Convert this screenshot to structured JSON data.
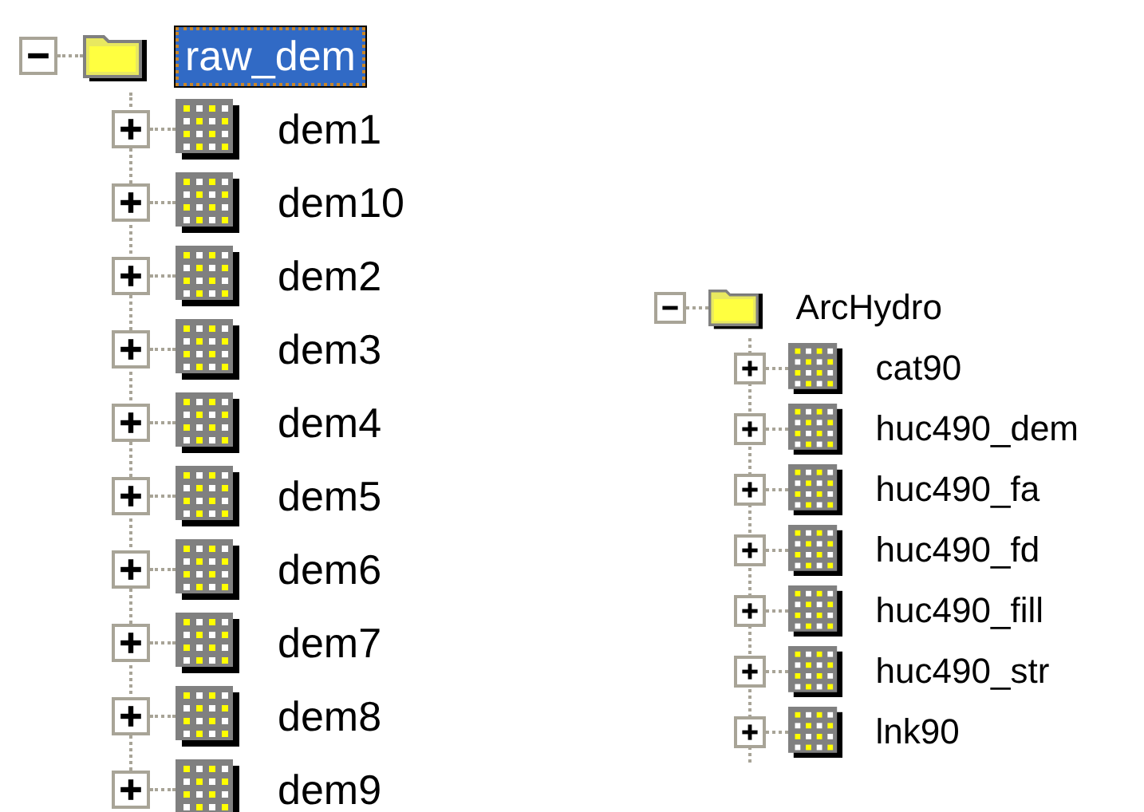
{
  "trees": [
    {
      "name": "raw_dem",
      "kind": "folder",
      "selected": true,
      "expanded": true,
      "children": [
        {
          "name": "dem1",
          "kind": "raster",
          "selected": false,
          "expanded": false
        },
        {
          "name": "dem10",
          "kind": "raster",
          "selected": false,
          "expanded": false
        },
        {
          "name": "dem2",
          "kind": "raster",
          "selected": false,
          "expanded": false
        },
        {
          "name": "dem3",
          "kind": "raster",
          "selected": false,
          "expanded": false
        },
        {
          "name": "dem4",
          "kind": "raster",
          "selected": false,
          "expanded": false
        },
        {
          "name": "dem5",
          "kind": "raster",
          "selected": false,
          "expanded": false
        },
        {
          "name": "dem6",
          "kind": "raster",
          "selected": false,
          "expanded": false
        },
        {
          "name": "dem7",
          "kind": "raster",
          "selected": false,
          "expanded": false
        },
        {
          "name": "dem8",
          "kind": "raster",
          "selected": false,
          "expanded": false
        },
        {
          "name": "dem9",
          "kind": "raster",
          "selected": false,
          "expanded": false
        }
      ]
    },
    {
      "name": "ArcHydro",
      "kind": "folder",
      "selected": false,
      "expanded": true,
      "children": [
        {
          "name": "cat90",
          "kind": "raster",
          "selected": false,
          "expanded": false
        },
        {
          "name": "huc490_dem",
          "kind": "raster",
          "selected": false,
          "expanded": false
        },
        {
          "name": "huc490_fa",
          "kind": "raster",
          "selected": false,
          "expanded": false
        },
        {
          "name": "huc490_fd",
          "kind": "raster",
          "selected": false,
          "expanded": false
        },
        {
          "name": "huc490_fill",
          "kind": "raster",
          "selected": false,
          "expanded": false
        },
        {
          "name": "huc490_str",
          "kind": "raster",
          "selected": false,
          "expanded": false
        },
        {
          "name": "lnk90",
          "kind": "raster",
          "selected": false,
          "expanded": false
        }
      ]
    }
  ]
}
